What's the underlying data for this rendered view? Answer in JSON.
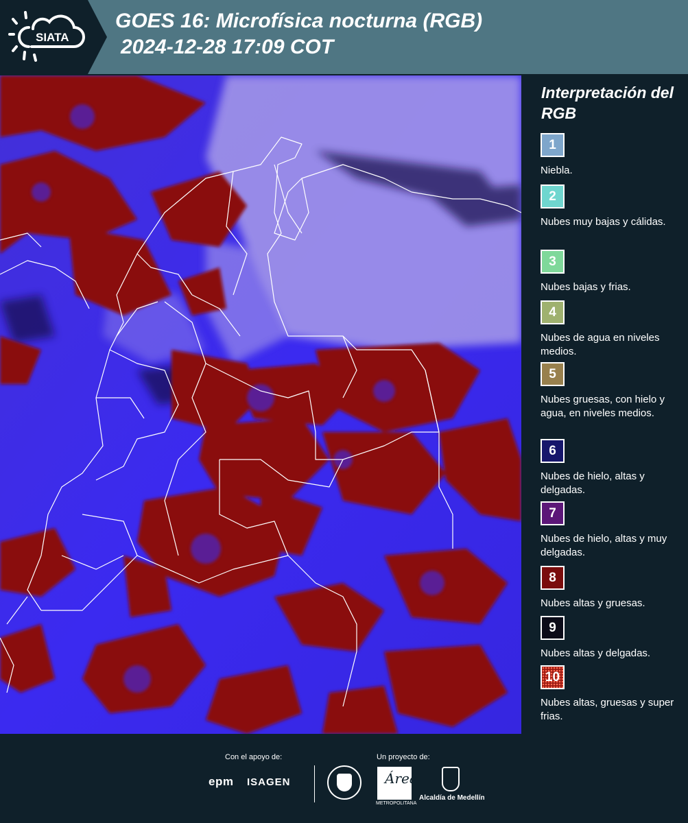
{
  "header": {
    "logo_text": "SIATA",
    "title_line1": "GOES 16: Microfísica nocturna (RGB)",
    "title_line2": "2024-12-28 17:09 COT"
  },
  "legend": {
    "title": "Interpretación del RGB",
    "items": [
      {
        "num": "1",
        "label": "Niebla.",
        "color": "#7ea6cb"
      },
      {
        "num": "2",
        "label": "Nubes muy bajas y cálidas.",
        "color": "#6fd6cf"
      },
      {
        "num": "3",
        "label": "Nubes bajas y frias.",
        "color": "#7fd89a"
      },
      {
        "num": "4",
        "label": "Nubes de agua en niveles medios.",
        "color": "#9fb16f"
      },
      {
        "num": "5",
        "label": "Nubes gruesas, con hielo y agua, en niveles medios.",
        "color": "#98804d"
      },
      {
        "num": "6",
        "label": "Nubes de hielo, altas y delgadas.",
        "color": "#16166b"
      },
      {
        "num": "7",
        "label": "Nubes de hielo, altas y muy delgadas.",
        "color": "#5c1778"
      },
      {
        "num": "8",
        "label": "Nubes altas y gruesas.",
        "color": "#7a0d0d"
      },
      {
        "num": "9",
        "label": "Nubes altas y delgadas.",
        "color": "#0b0b18"
      },
      {
        "num": "10",
        "label": "Nubes altas, gruesas y super frias.",
        "color": "#9a1a12"
      }
    ]
  },
  "footer": {
    "support_label": "Con el apoyo de:",
    "project_label": "Un proyecto de:",
    "epm": "epm",
    "isagen": "ISAGEN",
    "area_caption": "METROPOLITANA",
    "alcaldia": "Alcaldía de Medellín"
  },
  "map_colors": {
    "ice_blue": "#3b2af0",
    "thick_red": "#8a0c0c",
    "haze": "#b3a6e8",
    "border": "#ffffff"
  }
}
